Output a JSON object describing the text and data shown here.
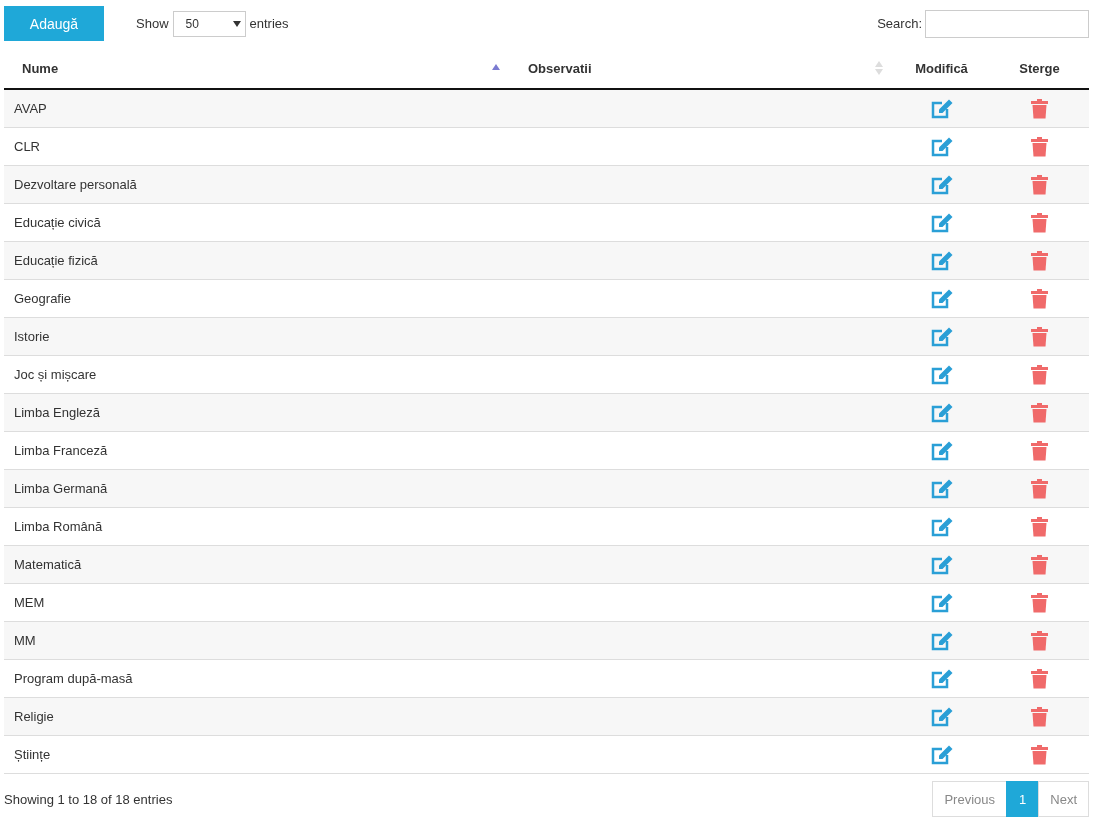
{
  "toolbar": {
    "add_button": "Adaugă",
    "show_label": "Show",
    "page_length": "50",
    "entries_label": "entries",
    "search_label": "Search:"
  },
  "columns": [
    {
      "label": "Nume",
      "sorted": true
    },
    {
      "label": "Observatii",
      "sorted": false
    },
    {
      "label": "Modifică"
    },
    {
      "label": "Sterge"
    }
  ],
  "rows": [
    {
      "nume": "AVAP"
    },
    {
      "nume": "CLR"
    },
    {
      "nume": "Dezvoltare personală"
    },
    {
      "nume": "Educație civică"
    },
    {
      "nume": "Educație fizică"
    },
    {
      "nume": "Geografie"
    },
    {
      "nume": "Istorie"
    },
    {
      "nume": "Joc și mișcare"
    },
    {
      "nume": "Limba Engleză"
    },
    {
      "nume": "Limba Franceză"
    },
    {
      "nume": "Limba Germană"
    },
    {
      "nume": "Limba Română"
    },
    {
      "nume": "Matematică"
    },
    {
      "nume": "MEM"
    },
    {
      "nume": "MM"
    },
    {
      "nume": "Program după-masă"
    },
    {
      "nume": "Religie"
    },
    {
      "nume": "Științe"
    }
  ],
  "info": "Showing 1 to 18 of 18 entries",
  "pagination": {
    "previous": {
      "label": "Previous",
      "disabled": true
    },
    "pages": [
      {
        "label": "1",
        "selected": true
      }
    ],
    "next": {
      "label": "Next",
      "disabled": true
    }
  }
}
